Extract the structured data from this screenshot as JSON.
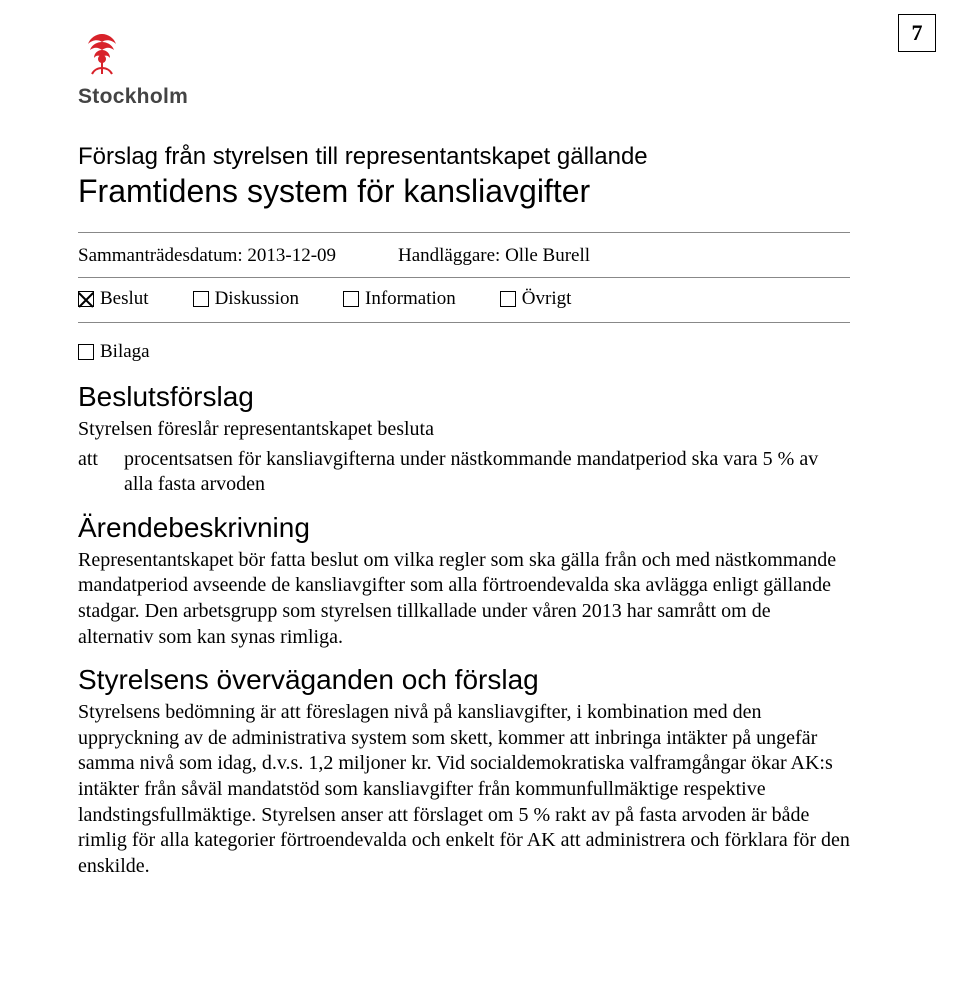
{
  "page_number": "7",
  "logo": {
    "text": "Stockholm",
    "icon": "rose-icon"
  },
  "header": {
    "pretitle": "Förslag från styrelsen till representantskapet gällande",
    "title": "Framtidens system för kansliavgifter"
  },
  "meta": {
    "date_label": "Sammanträdesdatum: 2013-12-09",
    "handler_label": "Handläggare: Olle Burell",
    "checkboxes": [
      {
        "label": "Beslut",
        "checked": true
      },
      {
        "label": "Diskussion",
        "checked": false
      },
      {
        "label": "Information",
        "checked": false
      },
      {
        "label": "Övrigt",
        "checked": false
      }
    ],
    "bilaga": {
      "label": "Bilaga",
      "checked": false
    }
  },
  "sections": {
    "beslut_heading": "Beslutsförslag",
    "beslut_intro": "Styrelsen föreslår representantskapet besluta",
    "att_label": "att",
    "att_text": "procentsatsen för kansliavgifterna under nästkommande mandatperiod ska vara 5 % av alla fasta arvoden",
    "arende_heading": "Ärendebeskrivning",
    "arende_text": "Representantskapet bör fatta beslut om vilka regler som ska gälla från och med nästkommande mandatperiod avseende de kansliavgifter som alla förtroendevalda ska avlägga enligt gällande stadgar. Den arbetsgrupp som styrelsen tillkallade under våren 2013 har samrått om de alternativ som kan synas rimliga.",
    "styrelsen_heading": "Styrelsens överväganden och förslag",
    "styrelsen_text": "Styrelsens bedömning är att föreslagen nivå på kansliavgifter, i kombination med den uppryckning av de administrativa system som skett, kommer att inbringa intäkter på ungefär samma nivå som idag, d.v.s. 1,2 miljoner kr. Vid socialdemokratiska valframgångar ökar AK:s intäkter från såväl mandatstöd som kansliavgifter från kommunfullmäktige respektive landstingsfullmäktige. Styrelsen anser att förslaget om 5 % rakt av på fasta arvoden är både rimlig för alla kategorier förtroendevalda och enkelt för AK att administrera och förklara för den enskilde."
  }
}
